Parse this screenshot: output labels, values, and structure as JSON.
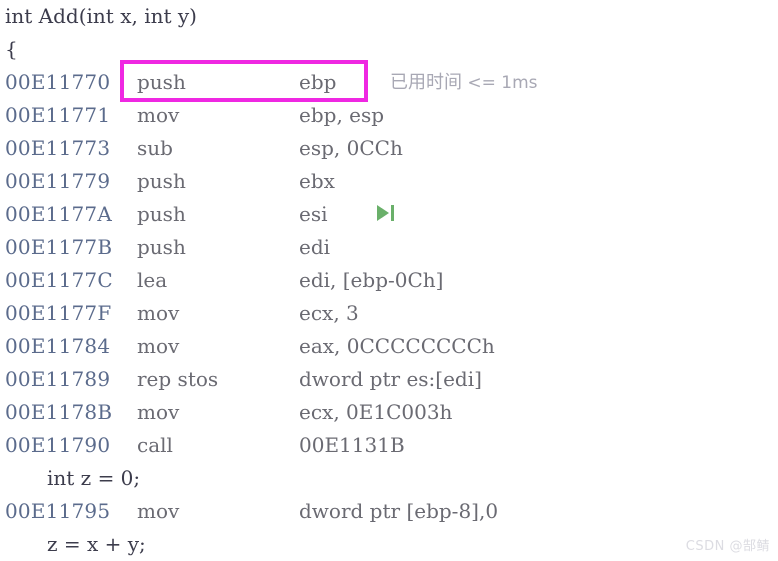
{
  "theme": {
    "background": "#ffffff",
    "address_color": "#5b6b8c",
    "code_color": "#6a6a72",
    "source_color": "#3c3c4c",
    "highlight_color": "#ef28e2",
    "tooltip_color": "#a8a8b4",
    "step_icon_color": "#6ab06a",
    "watermark_color": "#dcdce2"
  },
  "lines": [
    {
      "kind": "source",
      "text": "int Add(int x, int y)",
      "indent": false
    },
    {
      "kind": "source",
      "text": "{",
      "indent": false
    },
    {
      "kind": "asm",
      "address": "00E11770",
      "mnemonic": "push",
      "operands": "ebp"
    },
    {
      "kind": "asm",
      "address": "00E11771",
      "mnemonic": "mov",
      "operands": "ebp, esp"
    },
    {
      "kind": "asm",
      "address": "00E11773",
      "mnemonic": "sub",
      "operands": "esp, 0CCh"
    },
    {
      "kind": "asm",
      "address": "00E11779",
      "mnemonic": "push",
      "operands": "ebx"
    },
    {
      "kind": "asm",
      "address": "00E1177A",
      "mnemonic": "push",
      "operands": "esi"
    },
    {
      "kind": "asm",
      "address": "00E1177B",
      "mnemonic": "push",
      "operands": "edi"
    },
    {
      "kind": "asm",
      "address": "00E1177C",
      "mnemonic": "lea",
      "operands": "edi, [ebp-0Ch]"
    },
    {
      "kind": "asm",
      "address": "00E1177F",
      "mnemonic": "mov",
      "operands": "ecx, 3"
    },
    {
      "kind": "asm",
      "address": "00E11784",
      "mnemonic": "mov",
      "operands": "eax, 0CCCCCCCCh"
    },
    {
      "kind": "asm",
      "address": "00E11789",
      "mnemonic": "rep stos",
      "operands": "dword ptr es:[edi]"
    },
    {
      "kind": "asm",
      "address": "00E1178B",
      "mnemonic": "mov",
      "operands": "ecx, 0E1C003h"
    },
    {
      "kind": "asm",
      "address": "00E11790",
      "mnemonic": "call",
      "operands": "00E1131B"
    },
    {
      "kind": "source",
      "text": "int z = 0;",
      "indent": true
    },
    {
      "kind": "asm",
      "address": "00E11795",
      "mnemonic": "mov",
      "operands": "dword ptr [ebp-8],0"
    },
    {
      "kind": "source",
      "text": "z = x + y;",
      "indent": true
    }
  ],
  "highlight": {
    "target_address": "00E11770",
    "target_text": "push                ebp"
  },
  "elapsed_tooltip": {
    "label": "已用时间",
    "value": "<= 1ms"
  },
  "step_icon": {
    "name": "run-to-cursor-icon",
    "on_address": "00E1177A"
  },
  "watermark": {
    "text": "CSDN @郜鲭"
  }
}
